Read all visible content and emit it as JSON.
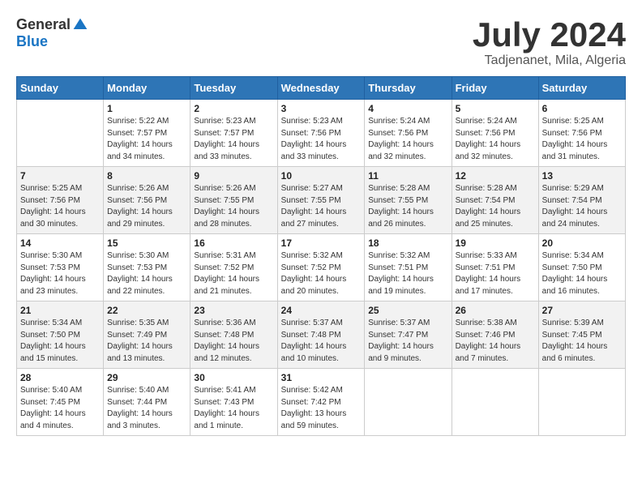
{
  "logo": {
    "general": "General",
    "blue": "Blue"
  },
  "title": "July 2024",
  "location": "Tadjenanet, Mila, Algeria",
  "days_of_week": [
    "Sunday",
    "Monday",
    "Tuesday",
    "Wednesday",
    "Thursday",
    "Friday",
    "Saturday"
  ],
  "weeks": [
    [
      {
        "day": "",
        "info": ""
      },
      {
        "day": "1",
        "info": "Sunrise: 5:22 AM\nSunset: 7:57 PM\nDaylight: 14 hours\nand 34 minutes."
      },
      {
        "day": "2",
        "info": "Sunrise: 5:23 AM\nSunset: 7:57 PM\nDaylight: 14 hours\nand 33 minutes."
      },
      {
        "day": "3",
        "info": "Sunrise: 5:23 AM\nSunset: 7:56 PM\nDaylight: 14 hours\nand 33 minutes."
      },
      {
        "day": "4",
        "info": "Sunrise: 5:24 AM\nSunset: 7:56 PM\nDaylight: 14 hours\nand 32 minutes."
      },
      {
        "day": "5",
        "info": "Sunrise: 5:24 AM\nSunset: 7:56 PM\nDaylight: 14 hours\nand 32 minutes."
      },
      {
        "day": "6",
        "info": "Sunrise: 5:25 AM\nSunset: 7:56 PM\nDaylight: 14 hours\nand 31 minutes."
      }
    ],
    [
      {
        "day": "7",
        "info": "Sunrise: 5:25 AM\nSunset: 7:56 PM\nDaylight: 14 hours\nand 30 minutes."
      },
      {
        "day": "8",
        "info": "Sunrise: 5:26 AM\nSunset: 7:56 PM\nDaylight: 14 hours\nand 29 minutes."
      },
      {
        "day": "9",
        "info": "Sunrise: 5:26 AM\nSunset: 7:55 PM\nDaylight: 14 hours\nand 28 minutes."
      },
      {
        "day": "10",
        "info": "Sunrise: 5:27 AM\nSunset: 7:55 PM\nDaylight: 14 hours\nand 27 minutes."
      },
      {
        "day": "11",
        "info": "Sunrise: 5:28 AM\nSunset: 7:55 PM\nDaylight: 14 hours\nand 26 minutes."
      },
      {
        "day": "12",
        "info": "Sunrise: 5:28 AM\nSunset: 7:54 PM\nDaylight: 14 hours\nand 25 minutes."
      },
      {
        "day": "13",
        "info": "Sunrise: 5:29 AM\nSunset: 7:54 PM\nDaylight: 14 hours\nand 24 minutes."
      }
    ],
    [
      {
        "day": "14",
        "info": "Sunrise: 5:30 AM\nSunset: 7:53 PM\nDaylight: 14 hours\nand 23 minutes."
      },
      {
        "day": "15",
        "info": "Sunrise: 5:30 AM\nSunset: 7:53 PM\nDaylight: 14 hours\nand 22 minutes."
      },
      {
        "day": "16",
        "info": "Sunrise: 5:31 AM\nSunset: 7:52 PM\nDaylight: 14 hours\nand 21 minutes."
      },
      {
        "day": "17",
        "info": "Sunrise: 5:32 AM\nSunset: 7:52 PM\nDaylight: 14 hours\nand 20 minutes."
      },
      {
        "day": "18",
        "info": "Sunrise: 5:32 AM\nSunset: 7:51 PM\nDaylight: 14 hours\nand 19 minutes."
      },
      {
        "day": "19",
        "info": "Sunrise: 5:33 AM\nSunset: 7:51 PM\nDaylight: 14 hours\nand 17 minutes."
      },
      {
        "day": "20",
        "info": "Sunrise: 5:34 AM\nSunset: 7:50 PM\nDaylight: 14 hours\nand 16 minutes."
      }
    ],
    [
      {
        "day": "21",
        "info": "Sunrise: 5:34 AM\nSunset: 7:50 PM\nDaylight: 14 hours\nand 15 minutes."
      },
      {
        "day": "22",
        "info": "Sunrise: 5:35 AM\nSunset: 7:49 PM\nDaylight: 14 hours\nand 13 minutes."
      },
      {
        "day": "23",
        "info": "Sunrise: 5:36 AM\nSunset: 7:48 PM\nDaylight: 14 hours\nand 12 minutes."
      },
      {
        "day": "24",
        "info": "Sunrise: 5:37 AM\nSunset: 7:48 PM\nDaylight: 14 hours\nand 10 minutes."
      },
      {
        "day": "25",
        "info": "Sunrise: 5:37 AM\nSunset: 7:47 PM\nDaylight: 14 hours\nand 9 minutes."
      },
      {
        "day": "26",
        "info": "Sunrise: 5:38 AM\nSunset: 7:46 PM\nDaylight: 14 hours\nand 7 minutes."
      },
      {
        "day": "27",
        "info": "Sunrise: 5:39 AM\nSunset: 7:45 PM\nDaylight: 14 hours\nand 6 minutes."
      }
    ],
    [
      {
        "day": "28",
        "info": "Sunrise: 5:40 AM\nSunset: 7:45 PM\nDaylight: 14 hours\nand 4 minutes."
      },
      {
        "day": "29",
        "info": "Sunrise: 5:40 AM\nSunset: 7:44 PM\nDaylight: 14 hours\nand 3 minutes."
      },
      {
        "day": "30",
        "info": "Sunrise: 5:41 AM\nSunset: 7:43 PM\nDaylight: 14 hours\nand 1 minute."
      },
      {
        "day": "31",
        "info": "Sunrise: 5:42 AM\nSunset: 7:42 PM\nDaylight: 13 hours\nand 59 minutes."
      },
      {
        "day": "",
        "info": ""
      },
      {
        "day": "",
        "info": ""
      },
      {
        "day": "",
        "info": ""
      }
    ]
  ]
}
